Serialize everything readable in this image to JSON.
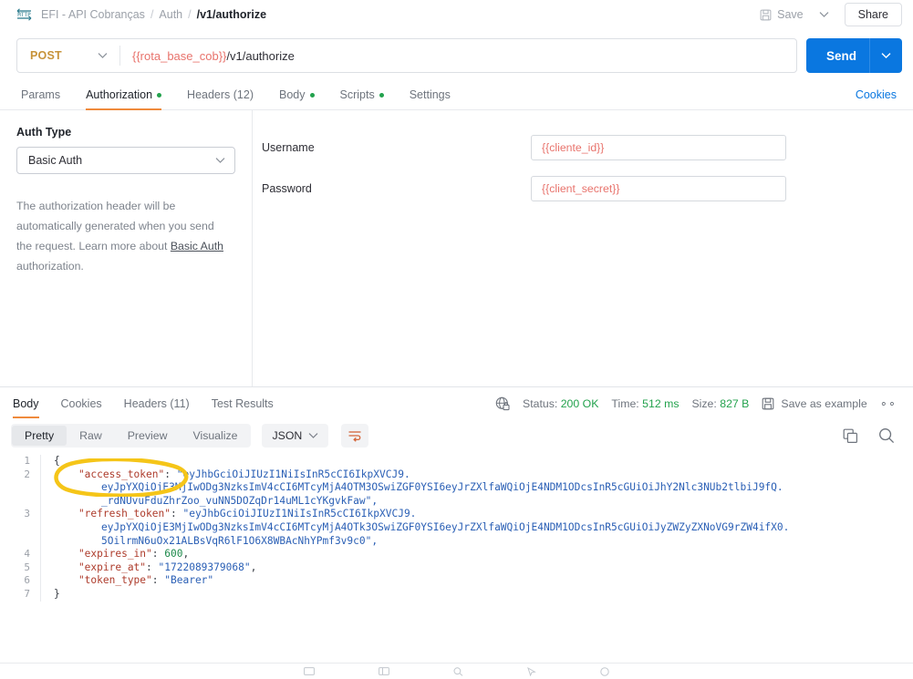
{
  "topbar": {
    "icon": "http-request-icon",
    "breadcrumb": [
      "EFI - API Cobranças",
      "Auth",
      "/v1/authorize"
    ],
    "separator": "/",
    "save_label": "Save",
    "save_icon": "floppy-disk-icon",
    "caret_icon": "chevron-down-icon",
    "share_label": "Share"
  },
  "url_bar": {
    "method": "POST",
    "method_caret": "chevron-down-icon",
    "url_variable": "{{rota_base_cob}}",
    "url_path": "/v1/authorize",
    "send_label": "Send",
    "send_caret": "chevron-down-icon"
  },
  "request_tabs": {
    "items": [
      {
        "label": "Params",
        "dot": false,
        "active": false
      },
      {
        "label": "Authorization",
        "dot": true,
        "active": true
      },
      {
        "label": "Headers (12)",
        "dot": false,
        "active": false
      },
      {
        "label": "Body",
        "dot": true,
        "active": false
      },
      {
        "label": "Scripts",
        "dot": true,
        "active": false
      },
      {
        "label": "Settings",
        "dot": false,
        "active": false
      }
    ],
    "cookies_link": "Cookies",
    "dot_color": "#23a24d",
    "active_underline_color": "#ef8a3c"
  },
  "auth": {
    "type_label": "Auth Type",
    "type_value": "Basic Auth",
    "type_caret": "chevron-down-icon",
    "help_text_1": "The authorization header will be automatically generated when you send the request. Learn more about ",
    "help_link": "Basic Auth",
    "help_text_2": " authorization.",
    "fields": [
      {
        "label": "Username",
        "value": "{{cliente_id}}"
      },
      {
        "label": "Password",
        "value": "{{client_secret}}"
      }
    ],
    "variable_color": "#e8736c"
  },
  "response": {
    "tabs": [
      {
        "label": "Body",
        "active": true
      },
      {
        "label": "Cookies",
        "active": false
      },
      {
        "label": "Headers (11)",
        "active": false
      },
      {
        "label": "Test Results",
        "active": false
      }
    ],
    "globe_icon": "globe-lock-icon",
    "status_label": "Status:",
    "status_value": "200 OK",
    "time_label": "Time:",
    "time_value": "512 ms",
    "size_label": "Size:",
    "size_value": "827 B",
    "save_example_icon": "floppy-disk-icon",
    "save_example_label": "Save as example",
    "more_icon": "ellipsis-icon",
    "status_color": "#23a24d"
  },
  "viewer": {
    "modes": [
      {
        "label": "Pretty",
        "active": true
      },
      {
        "label": "Raw",
        "active": false
      },
      {
        "label": "Preview",
        "active": false
      },
      {
        "label": "Visualize",
        "active": false
      }
    ],
    "format": "JSON",
    "format_caret": "chevron-down-icon",
    "wrap_icon": "word-wrap-icon",
    "copy_icon": "copy-icon",
    "search_icon": "search-icon"
  },
  "code": {
    "line_numbers": [
      "1",
      "2",
      "3",
      "4",
      "5",
      "6",
      "7"
    ],
    "lines": [
      {
        "n": "1",
        "segs": [
          {
            "t": "{",
            "c": "p"
          }
        ]
      },
      {
        "n": "2",
        "segs": [
          {
            "t": "    \"access_token\"",
            "c": "k"
          },
          {
            "t": ": ",
            "c": "p"
          },
          {
            "t": "\"eyJhbGciOiJIUzI1NiIsInR5cCI6IkpXVCJ9.",
            "c": "s"
          }
        ]
      },
      {
        "n": "2b",
        "segs": [
          {
            "t": "eyJpYXQiOjE3MjIwODg3NzksImV4cCI6MTcyMjA4OTM3OSwiZGF0YSI6eyJrZXlfaWQiOjE4NDM1ODcsInR5cGUiOiJhY2Nlc3NUb2tlbiJ9fQ.",
            "c": "s"
          }
        ]
      },
      {
        "n": "2c",
        "segs": [
          {
            "t": "_rdNUvuFduZhrZoo_vuNN5DOZqDr14uML1cYKgvkFaw\",",
            "c": "s"
          }
        ]
      },
      {
        "n": "3",
        "segs": [
          {
            "t": "    \"refresh_token\"",
            "c": "k"
          },
          {
            "t": ": ",
            "c": "p"
          },
          {
            "t": "\"eyJhbGciOiJIUzI1NiIsInR5cCI6IkpXVCJ9.",
            "c": "s"
          }
        ]
      },
      {
        "n": "3b",
        "segs": [
          {
            "t": "eyJpYXQiOjE3MjIwODg3NzksImV4cCI6MTcyMjA4OTk3OSwiZGF0YSI6eyJrZXlfaWQiOjE4NDM1ODcsInR5cGUiOiJyZWZyZXNoVG9rZW4ifX0.",
            "c": "s"
          }
        ]
      },
      {
        "n": "3c",
        "segs": [
          {
            "t": "5OilrmN6uOx21ALBsVqR6lF1O6X8WBAcNhYPmf3v9c0\",",
            "c": "s"
          }
        ]
      },
      {
        "n": "4",
        "segs": [
          {
            "t": "    \"expires_in\"",
            "c": "k"
          },
          {
            "t": ": ",
            "c": "p"
          },
          {
            "t": "600",
            "c": "n"
          },
          {
            "t": ",",
            "c": "p"
          }
        ]
      },
      {
        "n": "5",
        "segs": [
          {
            "t": "    \"expire_at\"",
            "c": "k"
          },
          {
            "t": ": ",
            "c": "p"
          },
          {
            "t": "\"1722089379068\"",
            "c": "s"
          },
          {
            "t": ",",
            "c": "p"
          }
        ]
      },
      {
        "n": "6",
        "segs": [
          {
            "t": "    \"token_type\"",
            "c": "k"
          },
          {
            "t": ": ",
            "c": "p"
          },
          {
            "t": "\"Bearer\"",
            "c": "s"
          }
        ]
      },
      {
        "n": "7",
        "segs": [
          {
            "t": "}",
            "c": "p"
          }
        ]
      }
    ],
    "annotation": {
      "shape": "hand-drawn-oval",
      "color": "#f5c518",
      "targets": "access_token"
    }
  },
  "bottombar": {
    "icons": [
      "console-icon",
      "layout-icon",
      "search-icon",
      "cursor-icon",
      "help-icon"
    ]
  }
}
